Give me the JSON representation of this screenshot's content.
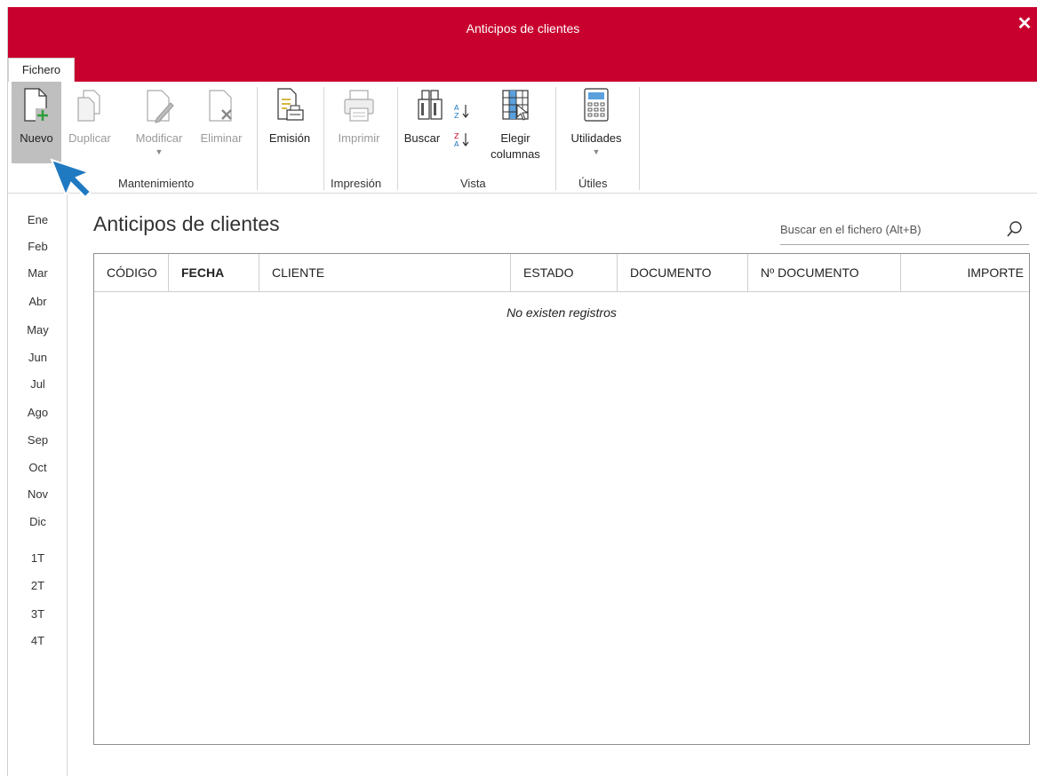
{
  "window": {
    "title": "Anticipos de clientes"
  },
  "tabs": {
    "fichero": "Fichero"
  },
  "ribbon": {
    "nuevo": "Nuevo",
    "duplicar": "Duplicar",
    "modificar": "Modificar",
    "eliminar": "Eliminar",
    "emision": "Emisión",
    "imprimir": "Imprimir",
    "buscar": "Buscar",
    "elegir_1": "Elegir",
    "elegir_2": "columnas",
    "utilidades": "Utilidades",
    "groups": {
      "mantenimiento": "Mantenimiento",
      "impresion": "Impresión",
      "vista": "Vista",
      "utiles": "Útiles"
    }
  },
  "months": [
    "Ene",
    "Feb",
    "Mar",
    "Abr",
    "May",
    "Jun",
    "Jul",
    "Ago",
    "Sep",
    "Oct",
    "Nov",
    "Dic",
    "1T",
    "2T",
    "3T",
    "4T"
  ],
  "page": {
    "title": "Anticipos de clientes"
  },
  "search": {
    "placeholder": "Buscar en el fichero (Alt+B)"
  },
  "table": {
    "columns": [
      "CÓDIGO",
      "FECHA",
      "CLIENTE",
      "ESTADO",
      "DOCUMENTO",
      "Nº DOCUMENTO",
      "IMPORTE"
    ],
    "empty_message": "No existen registros"
  },
  "colors": {
    "accent": "#c8002e",
    "pointer": "#1f7ac2"
  }
}
